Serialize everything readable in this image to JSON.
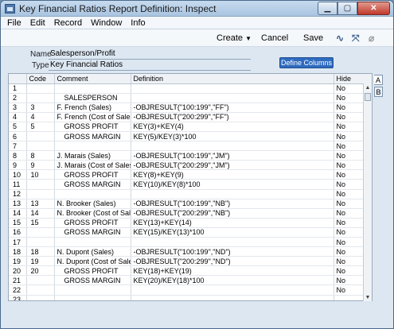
{
  "window": {
    "title": "Key Financial Ratios Report Definition: Inspect"
  },
  "window_controls": {
    "min": "▁",
    "max": "▢",
    "close": "✕"
  },
  "menu": [
    "File",
    "Edit",
    "Record",
    "Window",
    "Info"
  ],
  "toolbar": {
    "create": "Create",
    "cancel": "Cancel",
    "save": "Save"
  },
  "form": {
    "name_label": "Name",
    "name_value": "Salesperson/Profit",
    "type_label": "Type",
    "type_value": "Key Financial Ratios",
    "define_columns": "Define Columns"
  },
  "table": {
    "headers": [
      "",
      "Code",
      "Comment",
      "Definition",
      "Hide"
    ],
    "rows": [
      [
        "1",
        "",
        "",
        "",
        "No"
      ],
      [
        "2",
        "",
        "SALESPERSON",
        "",
        "No"
      ],
      [
        "3",
        "3",
        "F. French (Sales)",
        "-OBJRESULT(\"100:199\",\"FF\")",
        "No"
      ],
      [
        "4",
        "4",
        "F. French (Cost of Sales)",
        "-OBJRESULT(\"200:299\",\"FF\")",
        "No"
      ],
      [
        "5",
        "5",
        "GROSS PROFIT",
        "KEY(3)+KEY(4)",
        "No"
      ],
      [
        "6",
        "",
        "GROSS MARGIN",
        "KEY(5)/KEY(3)*100",
        "No"
      ],
      [
        "7",
        "",
        "",
        "",
        "No"
      ],
      [
        "8",
        "8",
        "J. Marais (Sales)",
        "-OBJRESULT(\"100:199\",\"JM\")",
        "No"
      ],
      [
        "9",
        "9",
        "J. Marais (Cost of Sales)",
        "-OBJRESULT(\"200:299\",\"JM\")",
        "No"
      ],
      [
        "10",
        "10",
        "GROSS PROFIT",
        "KEY(8)+KEY(9)",
        "No"
      ],
      [
        "11",
        "",
        "GROSS MARGIN",
        "KEY(10)/KEY(8)*100",
        "No"
      ],
      [
        "12",
        "",
        "",
        "",
        "No"
      ],
      [
        "13",
        "13",
        "N. Brooker (Sales)",
        "-OBJRESULT(\"100:199\",\"NB\")",
        "No"
      ],
      [
        "14",
        "14",
        "N. Brooker (Cost of Sales)",
        "-OBJRESULT(\"200:299\",\"NB\")",
        "No"
      ],
      [
        "15",
        "15",
        "GROSS PROFIT",
        "KEY(13)+KEY(14)",
        "No"
      ],
      [
        "16",
        "",
        "GROSS MARGIN",
        "KEY(15)/KEY(13)*100",
        "No"
      ],
      [
        "17",
        "",
        "",
        "",
        "No"
      ],
      [
        "18",
        "18",
        "N. Dupont (Sales)",
        "-OBJRESULT(\"100:199\",\"ND\")",
        "No"
      ],
      [
        "19",
        "19",
        "N. Dupont (Cost of Sales)",
        "-OBJRESULT(\"200:299\",\"ND\")",
        "No"
      ],
      [
        "20",
        "20",
        "GROSS PROFIT",
        "KEY(18)+KEY(19)",
        "No"
      ],
      [
        "21",
        "",
        "GROSS MARGIN",
        "KEY(20)/KEY(18)*100",
        "No"
      ],
      [
        "22",
        "",
        "",
        "",
        "No"
      ],
      [
        "23",
        "",
        "",
        "",
        ""
      ]
    ],
    "indented_comments": [
      "SALESPERSON",
      "GROSS PROFIT",
      "GROSS MARGIN"
    ]
  },
  "side_tabs": [
    "A",
    "B"
  ],
  "colors": {
    "accent": "#2f6bbf",
    "window_bg": "#dde7f2"
  }
}
